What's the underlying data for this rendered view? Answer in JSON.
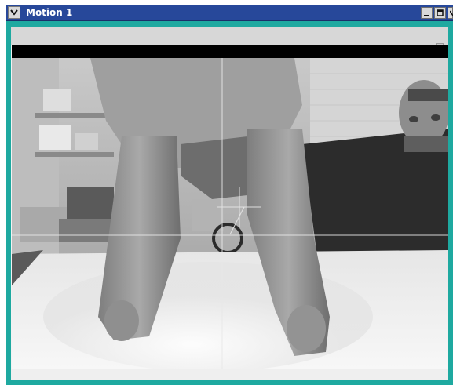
{
  "window": {
    "title": "Motion 1",
    "controls": {
      "menu": "window-menu-icon",
      "minimize": "minimize-icon",
      "maximize": "maximize-icon",
      "close": "close-icon"
    }
  },
  "colors": {
    "titlebar": "#27489a",
    "frame": "#1ea9a0",
    "crosshair": "#e8e8e8"
  },
  "video": {
    "description_icon": "camera-feed",
    "crosshair": true
  }
}
